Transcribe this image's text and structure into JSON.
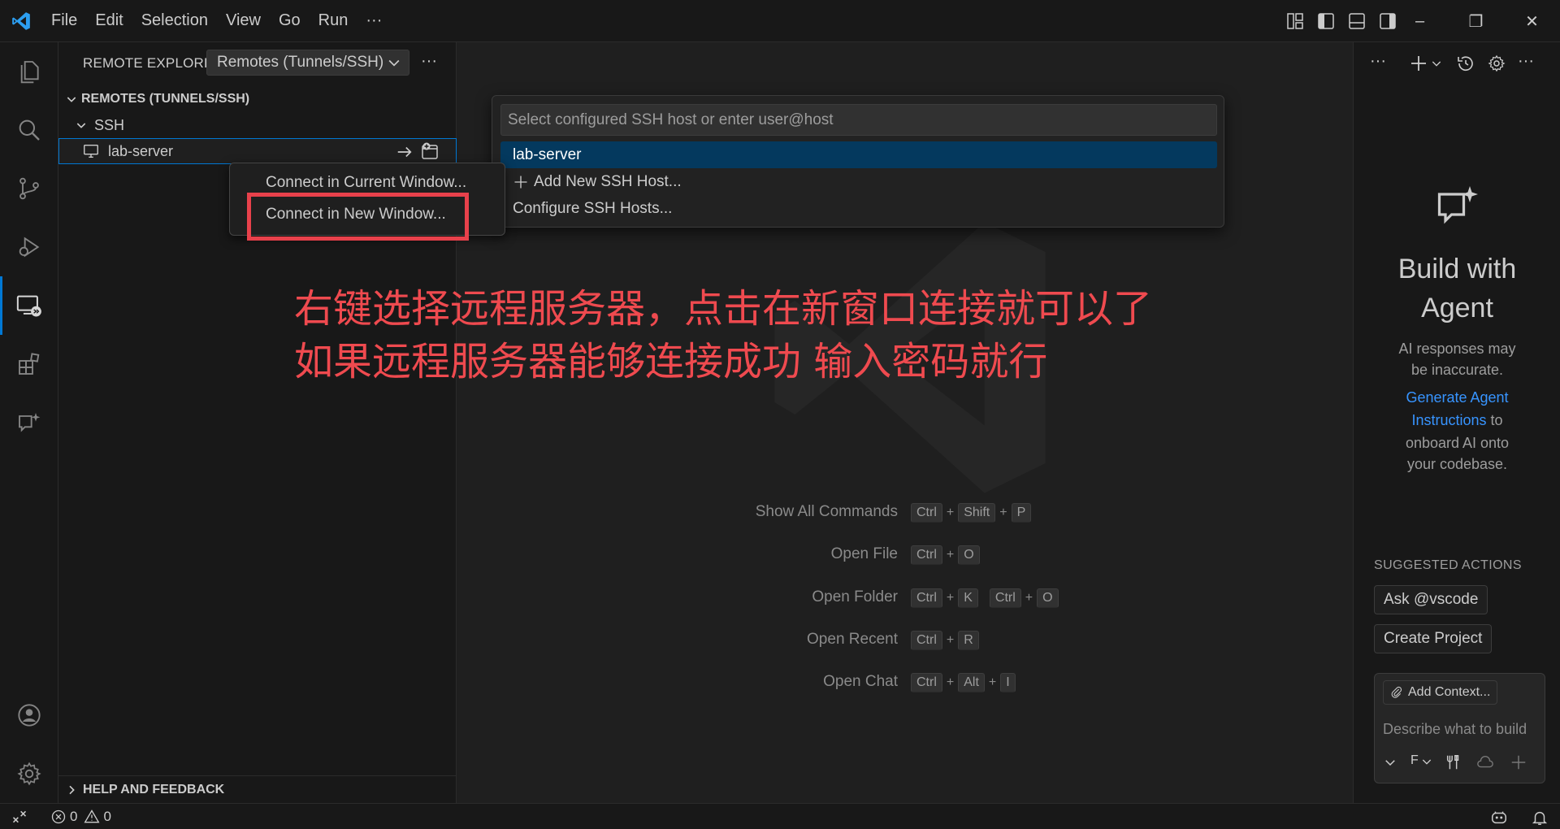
{
  "menu": {
    "items": [
      "File",
      "Edit",
      "Selection",
      "View",
      "Go",
      "Run"
    ],
    "more": "···"
  },
  "window_controls": {
    "minimize": "–",
    "restore": "❐",
    "close": "✕"
  },
  "activity_bar": {
    "icons": [
      "files-icon",
      "search-icon",
      "source-control-icon",
      "run-debug-icon",
      "remote-explorer-icon",
      "extensions-icon",
      "chat-icon"
    ],
    "bottom_icons": [
      "account-icon",
      "settings-gear-icon"
    ]
  },
  "sidebar": {
    "title": "REMOTE EXPLORER",
    "dropdown_value": "Remotes (Tunnels/SSH)",
    "more": "···",
    "section": "REMOTES (TUNNELS/SSH)",
    "group": "SSH",
    "host": "lab-server",
    "help": "HELP AND FEEDBACK"
  },
  "context_menu": {
    "items": [
      "Connect in Current Window...",
      "Connect in New Window..."
    ]
  },
  "quick_pick": {
    "placeholder": "Select configured SSH host or enter user@host",
    "items": [
      "lab-server",
      "Add New SSH Host...",
      "Configure SSH Hosts..."
    ]
  },
  "annotation": {
    "line1": "右键选择远程服务器，点击在新窗口连接就可以了",
    "line2": "如果远程服务器能够连接成功 输入密码就行"
  },
  "shortcuts": [
    {
      "label": "Show All Commands",
      "keys": [
        [
          "Ctrl",
          "Shift",
          "P"
        ]
      ]
    },
    {
      "label": "Open File",
      "keys": [
        [
          "Ctrl",
          "O"
        ]
      ]
    },
    {
      "label": "Open Folder",
      "keys": [
        [
          "Ctrl",
          "K"
        ],
        [
          "Ctrl",
          "O"
        ]
      ]
    },
    {
      "label": "Open Recent",
      "keys": [
        [
          "Ctrl",
          "R"
        ]
      ]
    },
    {
      "label": "Open Chat",
      "keys": [
        [
          "Ctrl",
          "Alt",
          "I"
        ]
      ]
    }
  ],
  "chat": {
    "title_line1": "Build with",
    "title_line2": "Agent",
    "disclaimer_line1": "AI responses may",
    "disclaimer_line2": "be inaccurate.",
    "link_line1": "Generate Agent",
    "link_line2": "Instructions",
    "after_link": " to",
    "rest_line1": "onboard AI onto",
    "rest_line2": "your codebase.",
    "suggested_title": "SUGGESTED ACTIONS",
    "suggested": [
      "Ask @vscode",
      "Create Project"
    ],
    "add_context": "Add Context...",
    "input_placeholder": "Describe what to build",
    "mode_letter": "F"
  },
  "status_bar": {
    "errors": "0",
    "warnings": "0"
  },
  "colors": {
    "accent": "#0078d4",
    "annotation": "#ef4a4f",
    "link": "#3794ff",
    "highlight_box": "#e8414b"
  }
}
